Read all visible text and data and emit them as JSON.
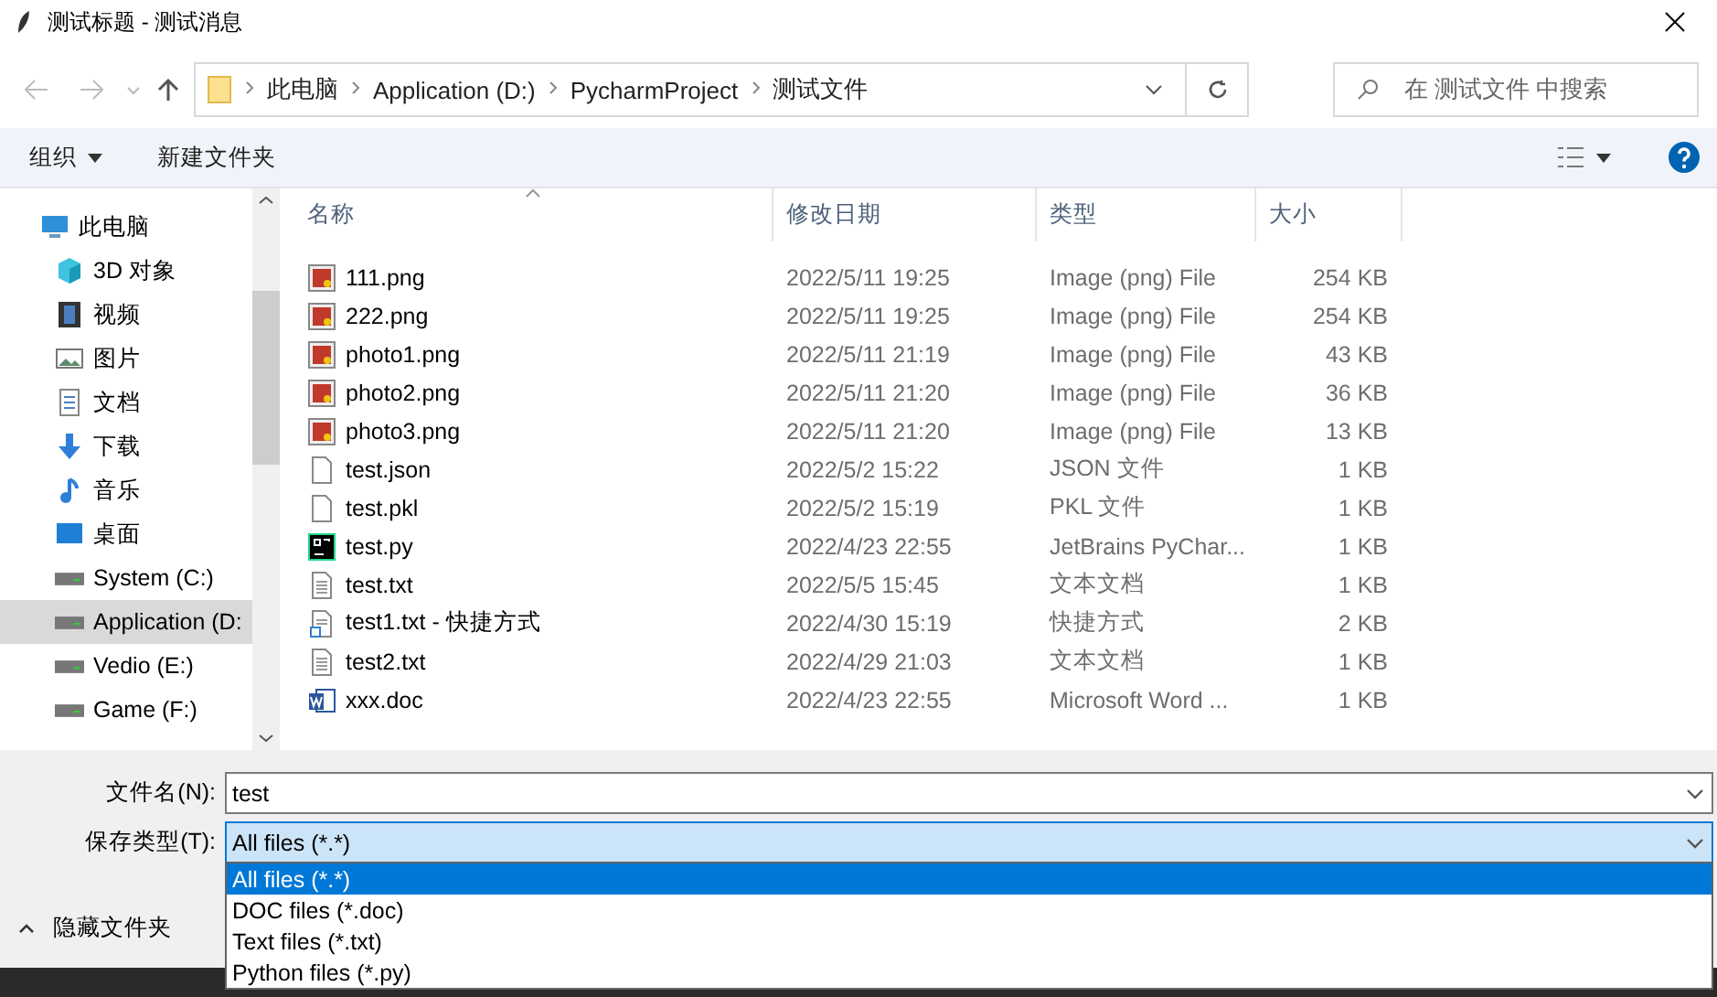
{
  "window": {
    "title": "测试标题 - 测试消息"
  },
  "address_bar": {
    "path": [
      "此电脑",
      "Application (D:)",
      "PycharmProject",
      "测试文件"
    ]
  },
  "search": {
    "placeholder": "在 测试文件 中搜索"
  },
  "toolbar": {
    "organize": "组织",
    "new_folder": "新建文件夹"
  },
  "sidebar": {
    "items": [
      {
        "label": "此电脑",
        "kind": "pc",
        "selected": false,
        "children": [
          {
            "label": "3D 对象",
            "kind": "cube",
            "selected": false
          },
          {
            "label": "视频",
            "kind": "video",
            "selected": false
          },
          {
            "label": "图片",
            "kind": "picture",
            "selected": false
          },
          {
            "label": "文档",
            "kind": "document",
            "selected": false
          },
          {
            "label": "下载",
            "kind": "download",
            "selected": false
          },
          {
            "label": "音乐",
            "kind": "music",
            "selected": false
          },
          {
            "label": "桌面",
            "kind": "desktop",
            "selected": false
          },
          {
            "label": "System (C:)",
            "kind": "drive",
            "selected": false
          },
          {
            "label": "Application (D:",
            "kind": "drive",
            "selected": true
          },
          {
            "label": "Vedio (E:)",
            "kind": "drive",
            "selected": false
          },
          {
            "label": "Game (F:)",
            "kind": "drive",
            "selected": false
          }
        ]
      }
    ]
  },
  "table": {
    "columns": [
      "名称",
      "修改日期",
      "类型",
      "大小"
    ],
    "rows": [
      {
        "name": "111.png",
        "kind": "image",
        "date": "2022/5/11 19:25",
        "type": "Image (png) File",
        "size": "254 KB"
      },
      {
        "name": "222.png",
        "kind": "image",
        "date": "2022/5/11 19:25",
        "type": "Image (png) File",
        "size": "254 KB"
      },
      {
        "name": "photo1.png",
        "kind": "image",
        "date": "2022/5/11 21:19",
        "type": "Image (png) File",
        "size": "43 KB"
      },
      {
        "name": "photo2.png",
        "kind": "image",
        "date": "2022/5/11 21:20",
        "type": "Image (png) File",
        "size": "36 KB"
      },
      {
        "name": "photo3.png",
        "kind": "image",
        "date": "2022/5/11 21:20",
        "type": "Image (png) File",
        "size": "13 KB"
      },
      {
        "name": "test.json",
        "kind": "blank",
        "date": "2022/5/2 15:22",
        "type": "JSON 文件",
        "size": "1 KB"
      },
      {
        "name": "test.pkl",
        "kind": "blank",
        "date": "2022/5/2 15:19",
        "type": "PKL 文件",
        "size": "1 KB"
      },
      {
        "name": "test.py",
        "kind": "pycharm",
        "date": "2022/4/23 22:55",
        "type": "JetBrains PyChar...",
        "size": "1 KB"
      },
      {
        "name": "test.txt",
        "kind": "text",
        "date": "2022/5/5 15:45",
        "type": "文本文档",
        "size": "1 KB"
      },
      {
        "name": "test1.txt - 快捷方式",
        "kind": "shortcut",
        "date": "2022/4/30 15:19",
        "type": "快捷方式",
        "size": "2 KB"
      },
      {
        "name": "test2.txt",
        "kind": "text",
        "date": "2022/4/29 21:03",
        "type": "文本文档",
        "size": "1 KB"
      },
      {
        "name": "xxx.doc",
        "kind": "word",
        "date": "2022/4/23 22:55",
        "type": "Microsoft Word ...",
        "size": "1 KB"
      }
    ]
  },
  "file_name": {
    "label": "文件名(N):",
    "value": "test"
  },
  "file_type": {
    "label": "保存类型(T):",
    "value": "All files (*.*)",
    "options": [
      {
        "label": "All files (*.*)",
        "selected": true
      },
      {
        "label": "DOC files (*.doc)",
        "selected": false
      },
      {
        "label": "Text files (*.txt)",
        "selected": false
      },
      {
        "label": "Python files (*.py)",
        "selected": false
      }
    ]
  },
  "hide_folders": {
    "label": "隐藏文件夹"
  }
}
